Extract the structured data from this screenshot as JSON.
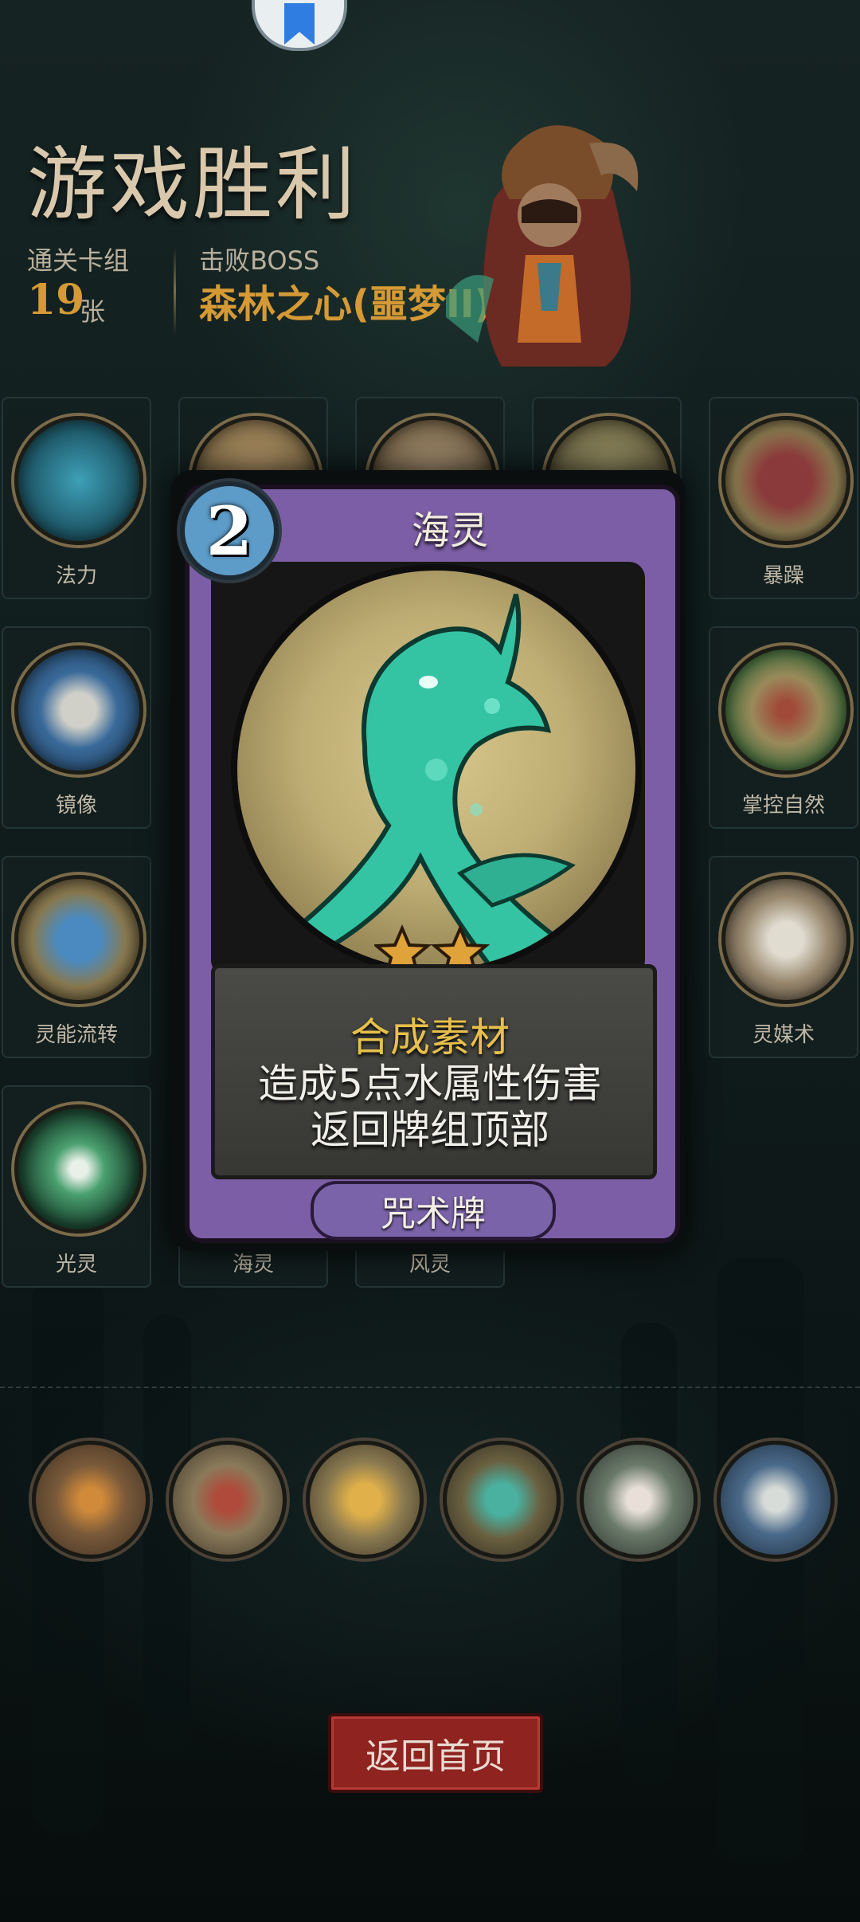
{
  "header": {
    "title": "游戏胜利",
    "deck_label": "通关卡组",
    "deck_count": "19",
    "deck_unit": "张",
    "boss_label": "击败BOSS",
    "boss_name": "森林之心(噩梦II)"
  },
  "cards": [
    {
      "label": "法力",
      "icon": "mana-icon"
    },
    {
      "label": "",
      "icon": "brawler-icon"
    },
    {
      "label": "",
      "icon": "shaman-icon"
    },
    {
      "label": "",
      "icon": "creature-icon"
    },
    {
      "label": "暴躁",
      "icon": "rage-icon"
    },
    {
      "label": "镜像",
      "icon": "mirror-icon"
    },
    {
      "label": "掌控自然",
      "icon": "nature-icon"
    },
    {
      "label": "灵能流转",
      "icon": "psionic-flow-icon"
    },
    {
      "label": "灵媒术",
      "icon": "mediumship-icon"
    },
    {
      "label": "光灵",
      "icon": "light-spirit-icon"
    },
    {
      "label": "海灵",
      "icon": "sea-spirit-icon"
    },
    {
      "label": "风灵",
      "icon": "wind-spirit-icon"
    }
  ],
  "detail_card": {
    "cost": "2",
    "name": "海灵",
    "stars": 2,
    "line1": "合成素材",
    "line2": "造成5点水属性伤害",
    "line3": "返回牌组顶部",
    "type": "咒术牌",
    "frame_color": "#7c5ea6",
    "accent_color": "#e7c04a"
  },
  "relics": [
    "candle-icon",
    "warrior-icon",
    "coins-icon",
    "spirit-hand-icon",
    "cards-hand-icon",
    "dagger-icon"
  ],
  "footer": {
    "home_button": "返回首页"
  }
}
